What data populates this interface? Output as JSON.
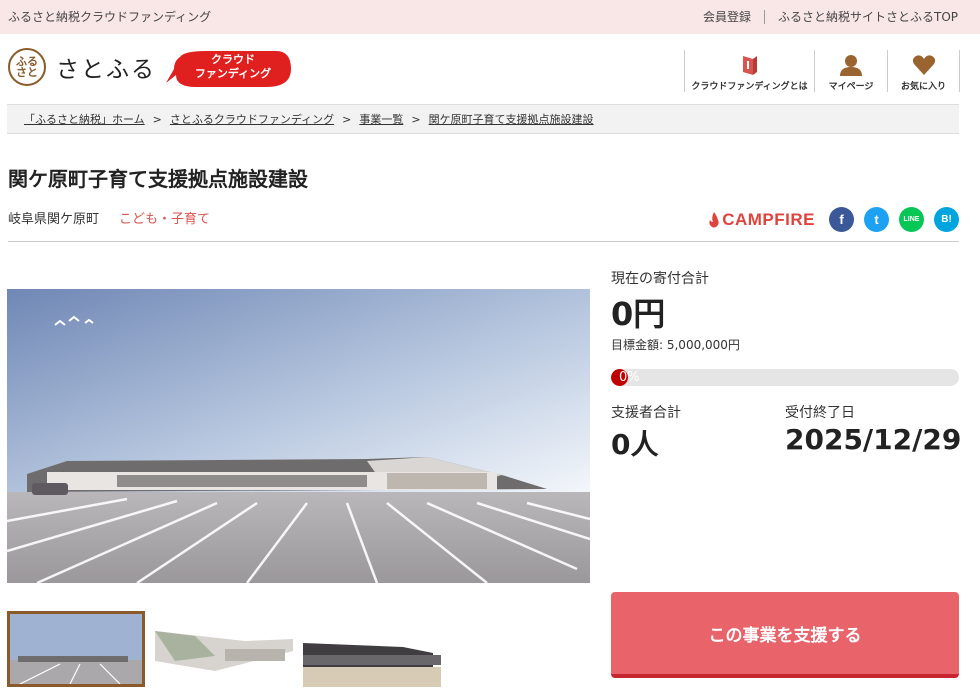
{
  "topbar": {
    "tagline": "ふるさと納税クラウドファンディング",
    "register": "会員登録",
    "top_link": "ふるさと納税サイトさとふるTOP"
  },
  "header": {
    "logo_seal": "ふる\nさと",
    "logo_text": "さとふる",
    "badge_line1": "クラウド",
    "badge_line2": "ファンディング",
    "nav": [
      {
        "label": "クラウドファンディングとは",
        "icon": "book-icon"
      },
      {
        "label": "マイページ",
        "icon": "user-icon"
      },
      {
        "label": "お気に入り",
        "icon": "heart-icon"
      }
    ]
  },
  "breadcrumb": [
    "「ふるさと納税」ホーム",
    "さとふるクラウドファンディング",
    "事業一覧",
    "関ケ原町子育て支援拠点施設建設"
  ],
  "breadcrumb_separator": ">",
  "project": {
    "title": "関ケ原町子育て支援拠点施設建設",
    "location": "岐阜県関ケ原町",
    "category": "こども・子育て"
  },
  "share": {
    "campfire": "CAMPFIRE",
    "facebook": "f",
    "twitter": "t",
    "line": "LINE",
    "hatena": "B!"
  },
  "stats": {
    "total_label": "現在の寄付合計",
    "total_value": "0円",
    "goal": "目標金額: 5,000,000円",
    "progress_text": "0%",
    "progress_percent": 0,
    "supporters_label": "支援者合計",
    "supporters_value": "0人",
    "deadline_label": "受付終了日",
    "deadline_value": "2025/12/29"
  },
  "support_button": "この事業を支援する",
  "colors": {
    "topbar_bg": "#f9e6e6",
    "accent_red": "#e8636a",
    "progress_fill": "#c00000",
    "brand_brown": "#8a5a2b"
  }
}
